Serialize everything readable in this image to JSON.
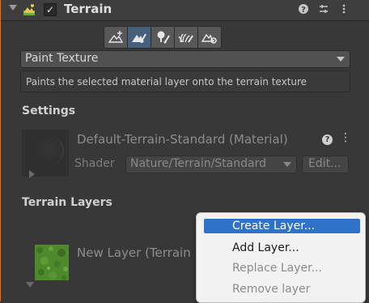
{
  "header": {
    "title": "Terrain",
    "enabled_checkbox": "✓",
    "help_icon": "?",
    "settings_icon": "⚙",
    "more_icon": "⋮"
  },
  "toolbar": {
    "tools": [
      {
        "icon": "raise-terrain-icon"
      },
      {
        "icon": "paint-terrain-icon",
        "active": true
      },
      {
        "icon": "paint-trees-icon"
      },
      {
        "icon": "paint-details-icon"
      },
      {
        "icon": "terrain-settings-icon"
      }
    ]
  },
  "paint_mode": {
    "selected": "Paint Texture",
    "description": "Paints the selected material layer onto the terrain texture"
  },
  "settings": {
    "heading": "Settings",
    "material_name": "Default-Terrain-Standard (Material)",
    "help_icon": "?",
    "more_icon": "⋮",
    "shader_label": "Shader",
    "shader_value": "Nature/Terrain/Standard",
    "edit_label": "Edit..."
  },
  "terrain_layers": {
    "heading": "Terrain Layers",
    "layer_name": "New Layer (Terrain"
  },
  "context_menu": {
    "items": [
      {
        "label": "Create Layer...",
        "state": "highlighted"
      },
      {
        "label": "Add Layer...",
        "state": "enabled"
      },
      {
        "label": "Replace Layer...",
        "state": "disabled"
      },
      {
        "label": "Remove layer",
        "state": "disabled"
      }
    ]
  },
  "colors": {
    "panel": "#383838",
    "accent_left_border": "#ff6a00",
    "active_tool": "#46607c",
    "menu_highlight": "#2f72c9"
  }
}
